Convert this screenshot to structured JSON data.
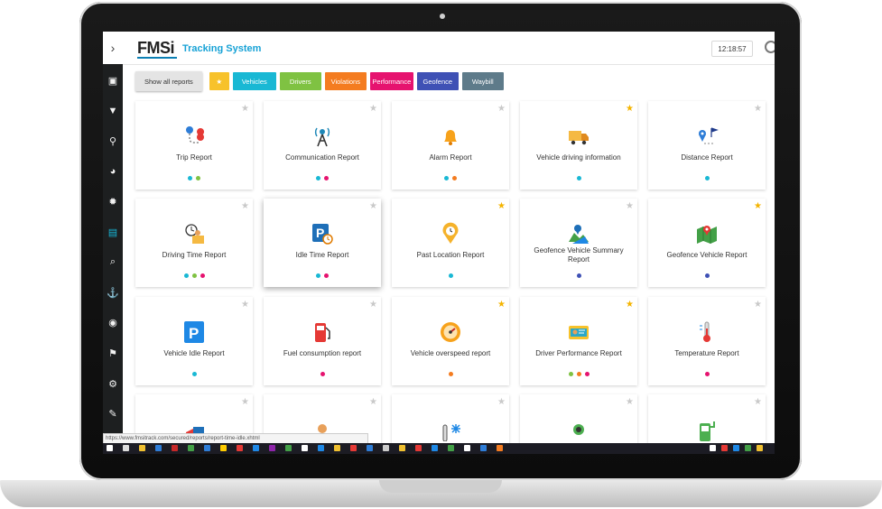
{
  "app": {
    "logo": "FMSi",
    "title": "Tracking System",
    "clock": "12:18:57"
  },
  "sidebar": {
    "toggle": "›",
    "items": [
      {
        "name": "sidebar-monitor-icon",
        "glyph": "▣"
      },
      {
        "name": "sidebar-filter-icon",
        "glyph": "▼"
      },
      {
        "name": "sidebar-route-icon",
        "glyph": "⚲"
      },
      {
        "name": "sidebar-dashboard-icon",
        "glyph": "◕"
      },
      {
        "name": "sidebar-settings-icon",
        "glyph": "✹"
      },
      {
        "name": "sidebar-reports-icon",
        "glyph": "▤"
      },
      {
        "name": "sidebar-search-icon",
        "glyph": "⌕"
      },
      {
        "name": "sidebar-anchor-icon",
        "glyph": "⚓"
      },
      {
        "name": "sidebar-gamepad-icon",
        "glyph": "◉"
      },
      {
        "name": "sidebar-location-icon",
        "glyph": "⚑"
      },
      {
        "name": "sidebar-cogs-icon",
        "glyph": "⚙"
      },
      {
        "name": "sidebar-wrench-icon",
        "glyph": "✎"
      }
    ]
  },
  "filters": {
    "show_all": "Show all reports",
    "star": "★",
    "tags": [
      {
        "label": "Vehicles",
        "color": "#19b8d4"
      },
      {
        "label": "Drivers",
        "color": "#7fc242"
      },
      {
        "label": "Violations",
        "color": "#f47c20"
      },
      {
        "label": "Performance",
        "color": "#e6136f"
      },
      {
        "label": "Geofence",
        "color": "#3f51b5"
      },
      {
        "label": "Waybill",
        "color": "#5e7b8a"
      }
    ]
  },
  "reports": [
    {
      "title": "Trip Report",
      "starred": false,
      "icon": "route-icon",
      "dots": [
        "#19b8d4",
        "#7fc242"
      ]
    },
    {
      "title": "Communication Report",
      "starred": false,
      "icon": "antenna-icon",
      "dots": [
        "#19b8d4",
        "#e6136f"
      ]
    },
    {
      "title": "Alarm Report",
      "starred": false,
      "icon": "bell-icon",
      "dots": [
        "#19b8d4",
        "#f47c20"
      ]
    },
    {
      "title": "Vehicle driving information",
      "starred": true,
      "icon": "truck-icon",
      "dots": [
        "#19b8d4"
      ]
    },
    {
      "title": "Distance Report",
      "starred": false,
      "icon": "distance-pin-icon",
      "dots": [
        "#19b8d4"
      ]
    },
    {
      "title": "Driving Time Report",
      "starred": false,
      "icon": "driver-clock-icon",
      "dots": [
        "#19b8d4",
        "#7fc242",
        "#e6136f"
      ]
    },
    {
      "title": "Idle Time Report",
      "starred": false,
      "icon": "parking-clock-icon",
      "dots": [
        "#19b8d4",
        "#e6136f"
      ]
    },
    {
      "title": "Past Location Report",
      "starred": true,
      "icon": "location-clock-icon",
      "dots": [
        "#19b8d4"
      ]
    },
    {
      "title": "Geofence Vehicle Summary Report",
      "starred": false,
      "icon": "map-pin-icon",
      "dots": [
        "#3f51b5"
      ]
    },
    {
      "title": "Geofence Vehicle Report",
      "starred": true,
      "icon": "map-icon",
      "dots": [
        "#3f51b5"
      ]
    },
    {
      "title": "Vehicle Idle Report",
      "starred": false,
      "icon": "parking-icon",
      "dots": [
        "#19b8d4"
      ]
    },
    {
      "title": "Fuel consumption report",
      "starred": false,
      "icon": "fuel-pump-icon",
      "dots": [
        "#e6136f"
      ]
    },
    {
      "title": "Vehicle overspeed report",
      "starred": true,
      "icon": "speedometer-icon",
      "dots": [
        "#f47c20"
      ]
    },
    {
      "title": "Driver Performance Report",
      "starred": true,
      "icon": "driver-card-icon",
      "dots": [
        "#7fc242",
        "#f47c20",
        "#e6136f"
      ]
    },
    {
      "title": "Temperature Report",
      "starred": false,
      "icon": "thermometer-icon",
      "dots": [
        "#e6136f"
      ]
    },
    {
      "title": "",
      "starred": false,
      "icon": "flag-icon",
      "dots": []
    },
    {
      "title": "",
      "starred": false,
      "icon": "person-icon",
      "dots": []
    },
    {
      "title": "",
      "starred": false,
      "icon": "snow-thermometer-icon",
      "dots": []
    },
    {
      "title": "",
      "starred": false,
      "icon": "battery-icon",
      "dots": []
    },
    {
      "title": "",
      "starred": false,
      "icon": "charging-station-icon",
      "dots": []
    }
  ],
  "status_url": "https://www.fmsitrack.com/secured/reports/report-time-idle.xhtml"
}
